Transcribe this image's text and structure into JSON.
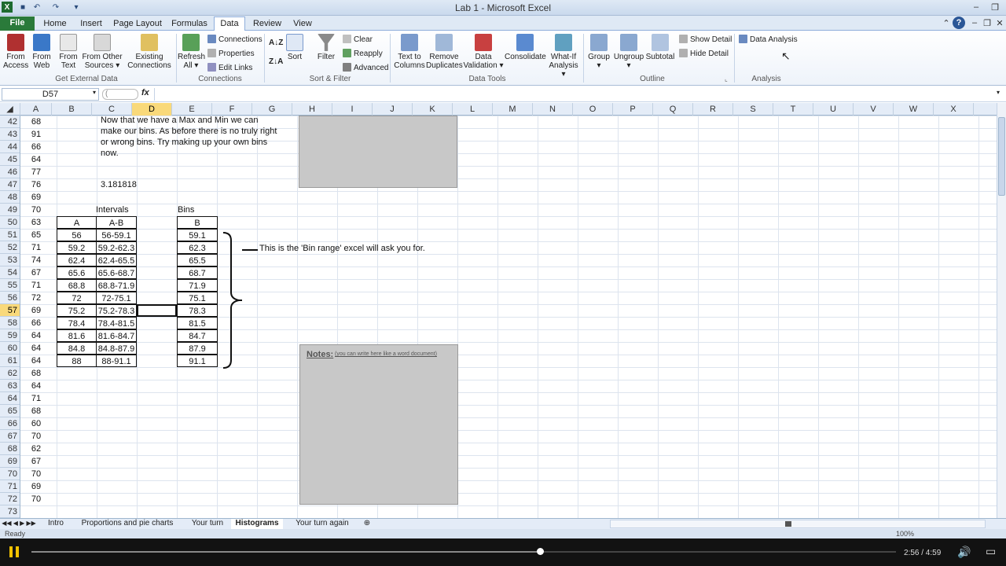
{
  "window": {
    "title": "Lab 1 - Microsoft Excel"
  },
  "tabs": [
    "File",
    "Home",
    "Insert",
    "Page Layout",
    "Formulas",
    "Data",
    "Review",
    "View"
  ],
  "active_tab": "Data",
  "ribbon": {
    "get_external_data": {
      "group": "Get External Data",
      "buttons": [
        {
          "l1": "From",
          "l2": "Access"
        },
        {
          "l1": "From",
          "l2": "Web"
        },
        {
          "l1": "From",
          "l2": "Text"
        },
        {
          "l1": "From Other",
          "l2": "Sources ▾"
        },
        {
          "l1": "Existing",
          "l2": "Connections"
        }
      ]
    },
    "connections": {
      "group": "Connections",
      "refresh": {
        "l1": "Refresh",
        "l2": "All ▾"
      },
      "items": [
        "Connections",
        "Properties",
        "Edit Links"
      ]
    },
    "sort_filter": {
      "group": "Sort & Filter",
      "sort": "Sort",
      "filter": "Filter",
      "items": [
        "Clear",
        "Reapply",
        "Advanced"
      ]
    },
    "data_tools": {
      "group": "Data Tools",
      "buttons": [
        {
          "l1": "Text to",
          "l2": "Columns"
        },
        {
          "l1": "Remove",
          "l2": "Duplicates"
        },
        {
          "l1": "Data",
          "l2": "Validation ▾"
        },
        {
          "l1": "Consolidate",
          "l2": ""
        },
        {
          "l1": "What-If",
          "l2": "Analysis ▾"
        }
      ]
    },
    "outline": {
      "group": "Outline",
      "buttons": [
        {
          "l1": "Group",
          "l2": "▾"
        },
        {
          "l1": "Ungroup",
          "l2": "▾"
        },
        {
          "l1": "Subtotal",
          "l2": ""
        }
      ],
      "items": [
        "Show Detail",
        "Hide Detail"
      ]
    },
    "analysis": {
      "group": "Analysis",
      "item": "Data Analysis"
    }
  },
  "formula_bar": {
    "name_box": "D57",
    "fx": "fx",
    "value": ""
  },
  "columns": [
    "A",
    "B",
    "C",
    "D",
    "E",
    "F",
    "G",
    "H",
    "I",
    "J",
    "K",
    "L",
    "M",
    "N",
    "O",
    "P",
    "Q",
    "R",
    "S",
    "T",
    "U",
    "V",
    "W",
    "X"
  ],
  "selected_column": "D",
  "rows": [
    42,
    43,
    44,
    45,
    46,
    47,
    48,
    49,
    50,
    51,
    52,
    53,
    54,
    55,
    56,
    57,
    58,
    59,
    60,
    61,
    62,
    63,
    64,
    65,
    66,
    67,
    68,
    69,
    70,
    71,
    72,
    73
  ],
  "selected_row": 57,
  "col_a_values": [
    "68",
    "91",
    "66",
    "64",
    "77",
    "76",
    "69",
    "70",
    "63",
    "65",
    "71",
    "74",
    "67",
    "71",
    "72",
    "69",
    "66",
    "64",
    "64",
    "64",
    "68",
    "64",
    "71",
    "68",
    "60",
    "70",
    "62",
    "67",
    "70",
    "69",
    "70"
  ],
  "note_text": "Now that we have a Max and Min we can make our bins.  As before there is no truly right or wrong bins.  Try making up your own bins now.",
  "c47_value": "3.181818",
  "intervals_label": "Intervals",
  "bins_label": "Bins",
  "table_headers": {
    "b": "A",
    "c": "A-B",
    "e": "B"
  },
  "table_b": [
    "56",
    "59.2",
    "62.4",
    "65.6",
    "68.8",
    "72",
    "75.2",
    "78.4",
    "81.6",
    "84.8",
    "88"
  ],
  "table_c": [
    "56-59.1",
    "59.2-62.3",
    "62.4-65.5",
    "65.6-68.7",
    "68.8-71.9",
    "72-75.1",
    "75.2-78.3",
    "78.4-81.5",
    "81.6-84.7",
    "84.8-87.9",
    "88-91.1"
  ],
  "table_e": [
    "59.1",
    "62.3",
    "65.5",
    "68.7",
    "71.9",
    "75.1",
    "78.3",
    "81.5",
    "84.7",
    "87.9",
    "91.1"
  ],
  "bin_range_text": "This is the 'Bin range' excel will ask you for.",
  "notes": {
    "title": "Notes:",
    "hint": "(you can write here like a word document)"
  },
  "sheet_tabs": [
    "Intro",
    "Proportions and pie charts",
    "Your turn",
    "Histograms",
    "Your turn again"
  ],
  "active_sheet": "Histograms",
  "status": {
    "left": "Ready",
    "zoom": "100%"
  },
  "player": {
    "time": "2:56 / 4:59",
    "progress": 0.588
  }
}
